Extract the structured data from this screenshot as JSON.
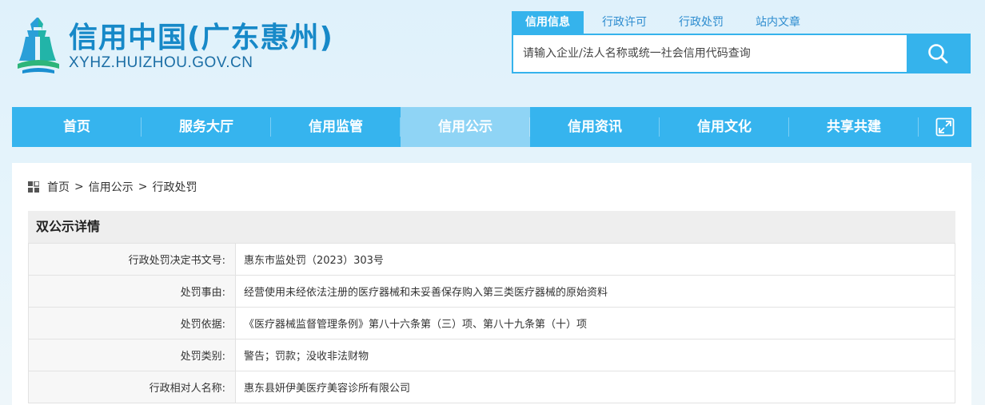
{
  "header": {
    "title": "信用中国(广东惠州)",
    "url": "XYHZ.HUIZHOU.GOV.CN"
  },
  "search": {
    "tabs": [
      {
        "label": "信用信息",
        "active": true
      },
      {
        "label": "行政许可",
        "active": false
      },
      {
        "label": "行政处罚",
        "active": false
      },
      {
        "label": "站内文章",
        "active": false
      }
    ],
    "placeholder": "请输入企业/法人名称或统一社会信用代码查询"
  },
  "nav": {
    "items": [
      "首页",
      "服务大厅",
      "信用监管",
      "信用公示",
      "信用资讯",
      "信用文化",
      "共享共建"
    ],
    "active_index": 3
  },
  "breadcrumb": [
    "首页",
    "信用公示",
    "行政处罚"
  ],
  "detail": {
    "title": "双公示详情",
    "rows": [
      {
        "key": "行政处罚决定书文号:",
        "value": "惠东市监处罚（2023）303号"
      },
      {
        "key": "处罚事由:",
        "value": "经营使用未经依法注册的医疗器械和未妥善保存购入第三类医疗器械的原始资料"
      },
      {
        "key": "处罚依据:",
        "value": "《医疗器械监督管理条例》第八十六条第（三）项、第八十九条第（十）项"
      },
      {
        "key": "处罚类别:",
        "value": "警告；罚款；没收非法财物"
      },
      {
        "key": "行政相对人名称:",
        "value": "惠东县妍伊美医疗美容诊所有限公司"
      }
    ]
  },
  "colors": {
    "primary": "#36b4ee",
    "nav_active": "#8fd4f5",
    "title_blue": "#1789c8"
  }
}
